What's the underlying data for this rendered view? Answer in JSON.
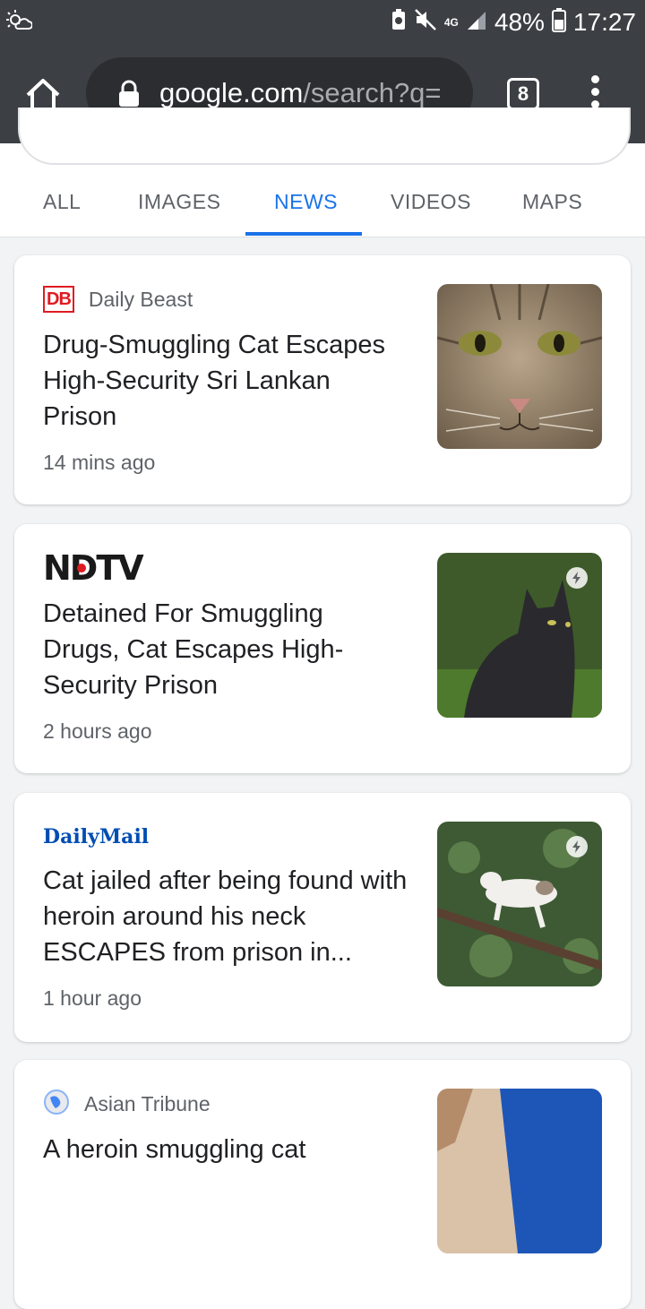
{
  "status_bar": {
    "battery": "48%",
    "time": "17:27",
    "network": "4G"
  },
  "browser": {
    "url_host": "google.com",
    "url_path": "/search?q=",
    "tab_count": "8"
  },
  "search_tabs": [
    {
      "label": "ALL",
      "active": false
    },
    {
      "label": "IMAGES",
      "active": false
    },
    {
      "label": "NEWS",
      "active": true
    },
    {
      "label": "VIDEOS",
      "active": false
    },
    {
      "label": "MAPS",
      "active": false
    }
  ],
  "results": [
    {
      "source": "Daily Beast",
      "source_logo_text": "DB",
      "headline": "Drug-Smuggling Cat Escapes High-Security Sri Lankan Prison",
      "time": "14 mins ago"
    },
    {
      "source": "NDTV",
      "source_logo_text": "NDTV",
      "headline": "Detained For Smuggling Drugs, Cat Escapes High-Security Prison",
      "time": "2 hours ago"
    },
    {
      "source": "Daily Mail",
      "source_logo_text": "DailyMail",
      "headline": "Cat jailed after being found with heroin around his neck ESCAPES from prison in...",
      "time": "1 hour ago"
    },
    {
      "source": "Asian Tribune",
      "headline": "A heroin smuggling cat"
    }
  ],
  "colors": {
    "accent": "#1a73e8",
    "toolbar": "#3c3f43",
    "db_red": "#e01b22",
    "daily_mail_blue": "#004db3"
  }
}
